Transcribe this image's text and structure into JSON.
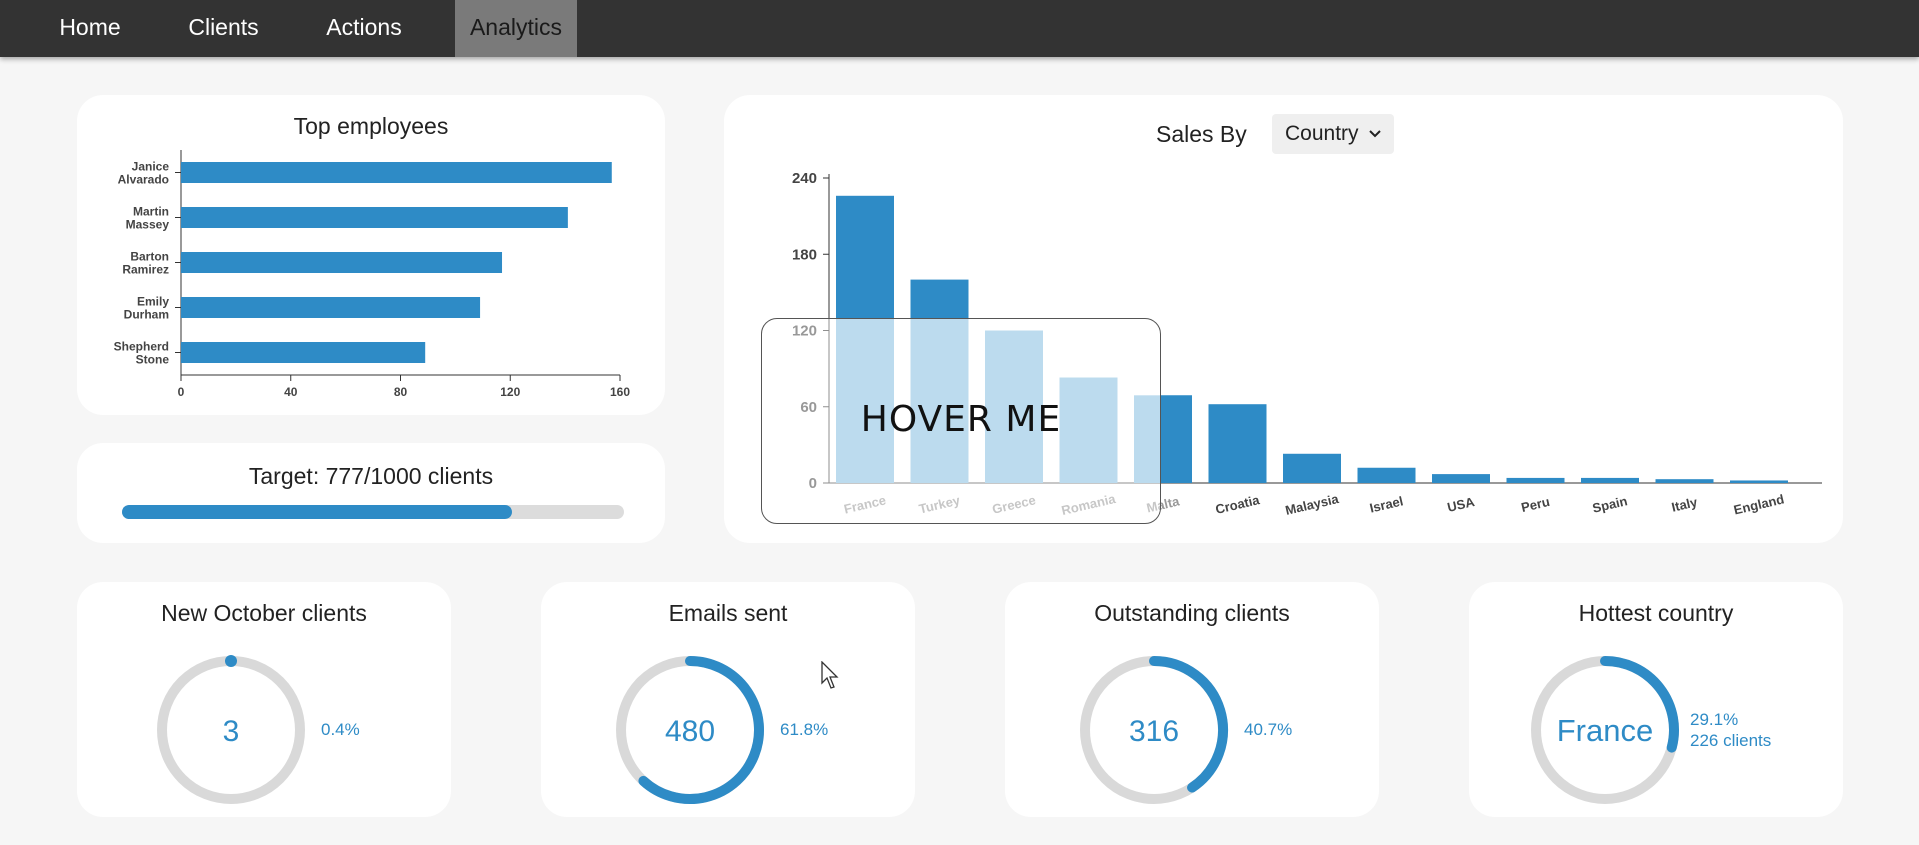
{
  "nav": {
    "items": [
      {
        "label": "Home",
        "active": false
      },
      {
        "label": "Clients",
        "active": false
      },
      {
        "label": "Actions",
        "active": false
      },
      {
        "label": "Analytics",
        "active": true
      }
    ]
  },
  "top_employees": {
    "title": "Top employees",
    "chart_data": {
      "type": "bar",
      "orientation": "horizontal",
      "categories": [
        [
          "Janice",
          "Alvarado"
        ],
        [
          "Martin",
          "Massey"
        ],
        [
          "Barton",
          "Ramirez"
        ],
        [
          "Emily",
          "Durham"
        ],
        [
          "Shepherd",
          "Stone"
        ]
      ],
      "values": [
        157,
        141,
        117,
        109,
        89
      ],
      "xticks": [
        0,
        40,
        80,
        120,
        160
      ],
      "xlim": [
        0,
        160
      ],
      "color": "#2e8bc6"
    }
  },
  "target": {
    "label": "Target: 777/1000 clients",
    "current": 777,
    "total": 1000
  },
  "sales": {
    "title": "Sales By",
    "dropdown_value": "Country",
    "hover_label": "HOVER ME",
    "chart_data": {
      "type": "bar",
      "categories": [
        "France",
        "Turkey",
        "Greece",
        "Romania",
        "Malta",
        "Croatia",
        "Malaysia",
        "Israel",
        "USA",
        "Peru",
        "Spain",
        "Italy",
        "England"
      ],
      "values": [
        226,
        160,
        120,
        83,
        69,
        62,
        23,
        12,
        7,
        4,
        4,
        3,
        2
      ],
      "yticks": [
        0,
        60,
        120,
        180,
        240
      ],
      "ylim": [
        0,
        240
      ],
      "color": "#2e8bc6",
      "highlight_color": "#85bde0"
    }
  },
  "kpis": [
    {
      "title": "New October clients",
      "value": "3",
      "percent": "0.4%",
      "fraction": 0.004
    },
    {
      "title": "Emails sent",
      "value": "480",
      "percent": "61.8%",
      "fraction": 0.618
    },
    {
      "title": "Outstanding clients",
      "value": "316",
      "percent": "40.7%",
      "fraction": 0.407
    },
    {
      "title": "Hottest country",
      "value": "France",
      "percent": "29.1%",
      "extra": "226 clients",
      "fraction": 0.291
    }
  ],
  "colors": {
    "accent": "#2e8bc6",
    "track": "#d9d9d9",
    "nav_bg": "#333333",
    "nav_active": "#7a7a7a"
  }
}
